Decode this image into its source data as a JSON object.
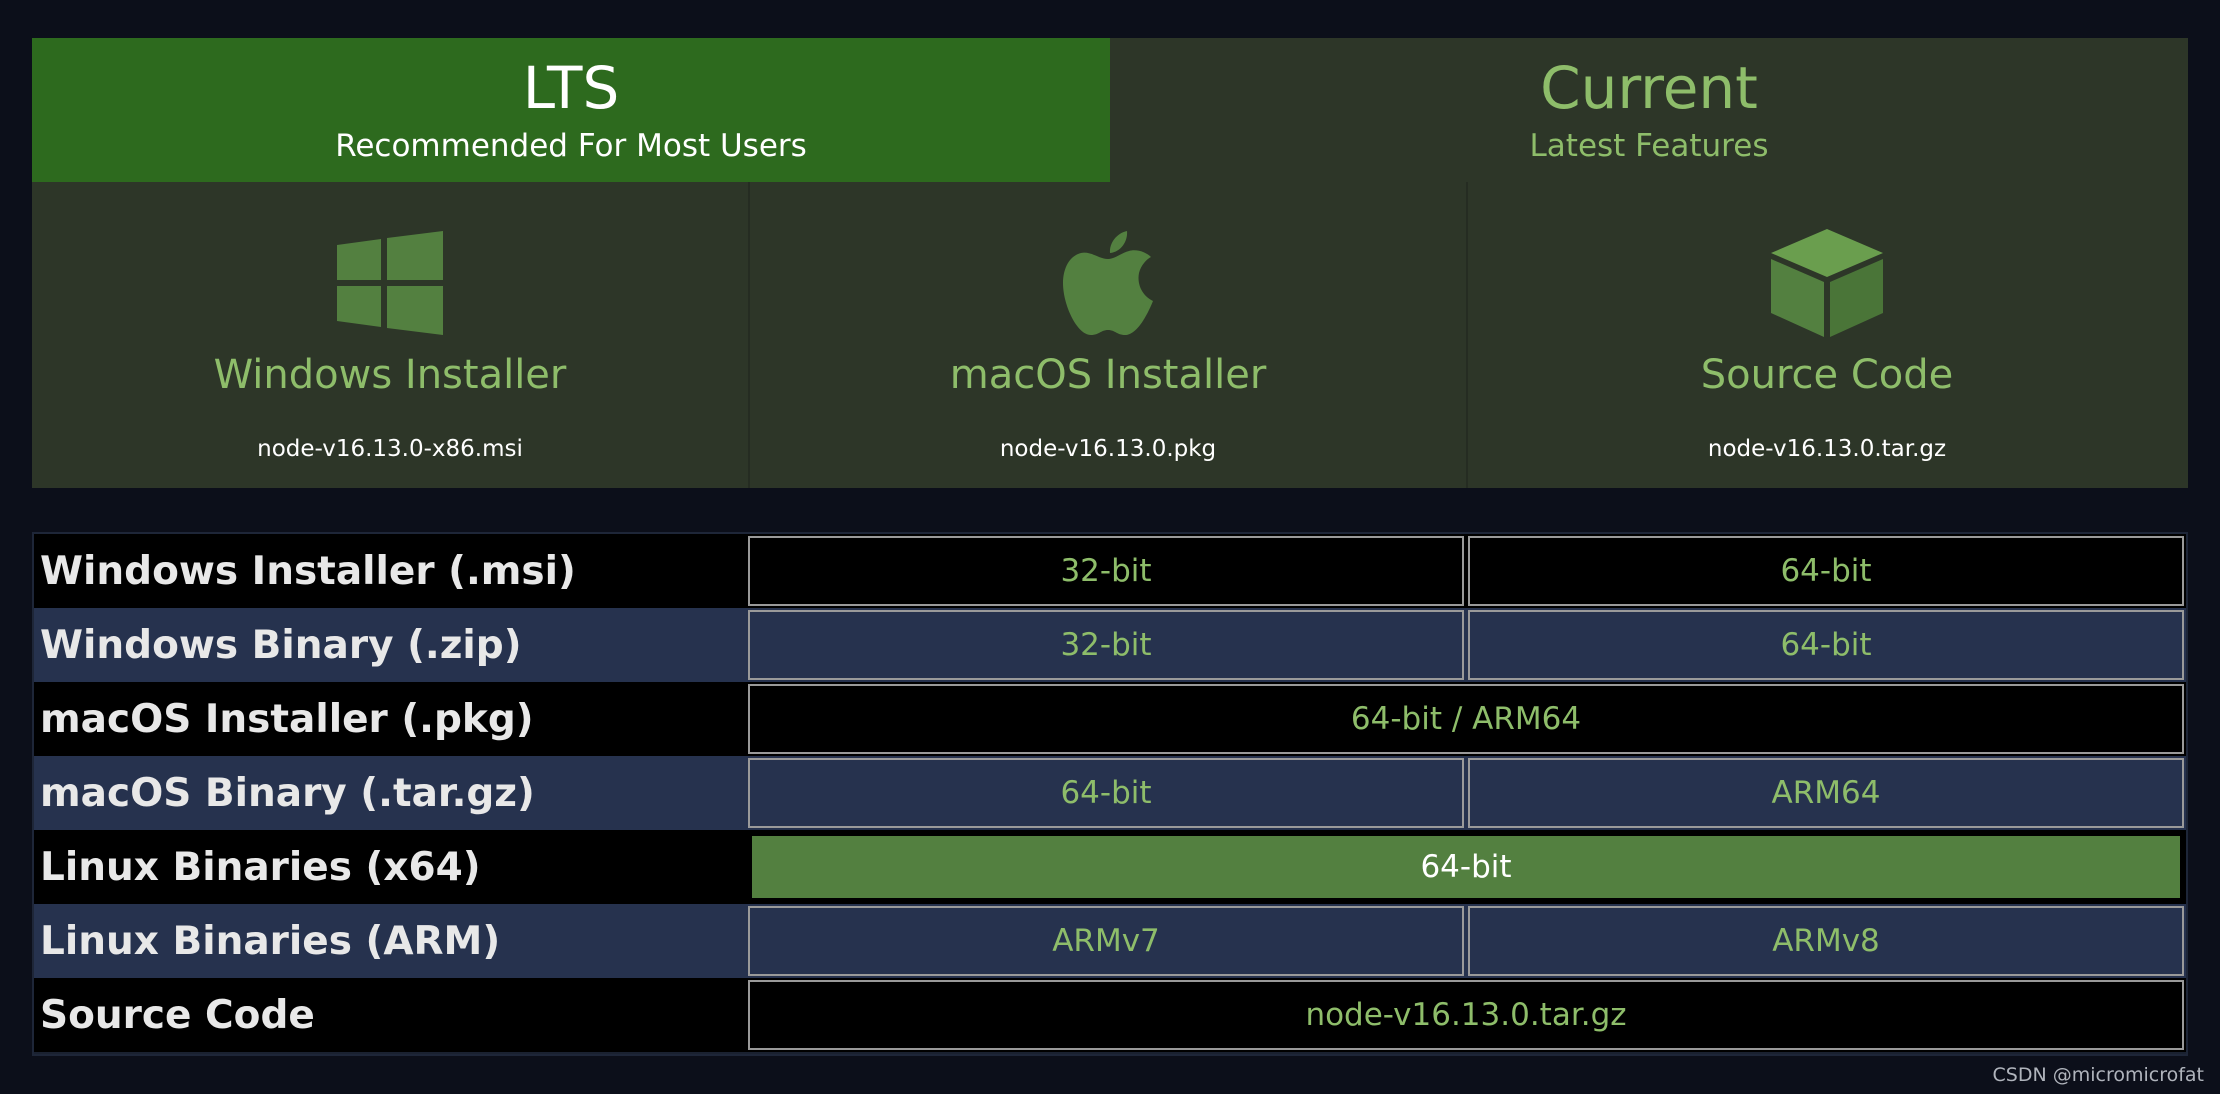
{
  "tabs": {
    "lts": {
      "title": "LTS",
      "subtitle": "Recommended For Most Users"
    },
    "current": {
      "title": "Current",
      "subtitle": "Latest Features"
    }
  },
  "downloads": [
    {
      "label": "Windows Installer",
      "file": "node-v16.13.0-x86.msi",
      "icon": "windows-icon"
    },
    {
      "label": "macOS Installer",
      "file": "node-v16.13.0.pkg",
      "icon": "apple-icon"
    },
    {
      "label": "Source Code",
      "file": "node-v16.13.0.tar.gz",
      "icon": "box-icon"
    }
  ],
  "table": {
    "rows": [
      {
        "label": "Windows Installer (.msi)",
        "cells": [
          "32-bit",
          "64-bit"
        ]
      },
      {
        "label": "Windows Binary (.zip)",
        "cells": [
          "32-bit",
          "64-bit"
        ]
      },
      {
        "label": "macOS Installer (.pkg)",
        "cells": [
          "64-bit / ARM64"
        ]
      },
      {
        "label": "macOS Binary (.tar.gz)",
        "cells": [
          "64-bit",
          "ARM64"
        ]
      },
      {
        "label": "Linux Binaries (x64)",
        "cells": [
          "64-bit"
        ]
      },
      {
        "label": "Linux Binaries (ARM)",
        "cells": [
          "ARMv7",
          "ARMv8"
        ]
      },
      {
        "label": "Source Code",
        "cells": [
          "node-v16.13.0.tar.gz"
        ]
      }
    ]
  },
  "watermark": "CSDN @micromicrofat",
  "colors": {
    "accent": "#2d6a1e",
    "link": "#8ebd6a",
    "panel": "#2d3628",
    "row_alt": "#26324e"
  }
}
